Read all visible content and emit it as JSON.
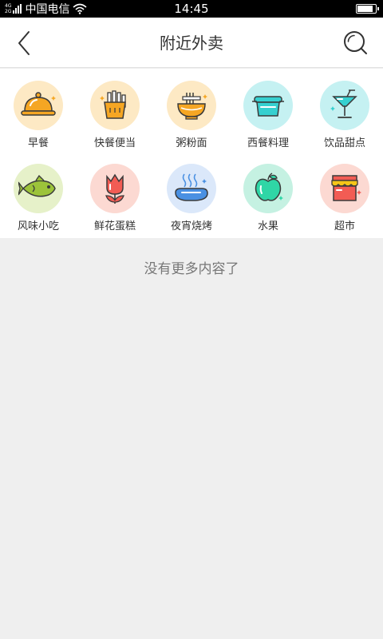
{
  "status_bar": {
    "network_top": "4G",
    "network_bottom": "2G",
    "carrier": "中国电信",
    "time": "14:45",
    "battery_level": 0.9
  },
  "header": {
    "title": "附近外卖",
    "back_icon": "back-arrow-icon",
    "search_icon": "search-icon"
  },
  "categories": [
    {
      "label": "早餐",
      "icon": "breakfast-cloche-icon",
      "bg": "#fde9c4"
    },
    {
      "label": "快餐便当",
      "icon": "fast-food-fries-icon",
      "bg": "#fde9c4"
    },
    {
      "label": "粥粉面",
      "icon": "noodle-bowl-icon",
      "bg": "#fde9c4"
    },
    {
      "label": "西餐料理",
      "icon": "western-dish-icon",
      "bg": "#c5f1f2"
    },
    {
      "label": "饮品甜点",
      "icon": "drink-cocktail-icon",
      "bg": "#c5f1f2"
    },
    {
      "label": "风味小吃",
      "icon": "fish-icon",
      "bg": "#e6f1c9"
    },
    {
      "label": "鲜花蛋糕",
      "icon": "tulip-flower-icon",
      "bg": "#fcd9d2"
    },
    {
      "label": "夜宵烧烤",
      "icon": "sausage-bbq-icon",
      "bg": "#dbe8fa"
    },
    {
      "label": "水果",
      "icon": "apple-fruit-icon",
      "bg": "#c5f1e2"
    },
    {
      "label": "超市",
      "icon": "supermarket-store-icon",
      "bg": "#fcd9d2"
    }
  ],
  "footer_text": "没有更多内容了",
  "colors": {
    "orange": "#f5a623",
    "teal": "#35d0d0",
    "red": "#f25c54",
    "blue": "#4a90e2",
    "dark_outline": "#3a3a3a"
  }
}
